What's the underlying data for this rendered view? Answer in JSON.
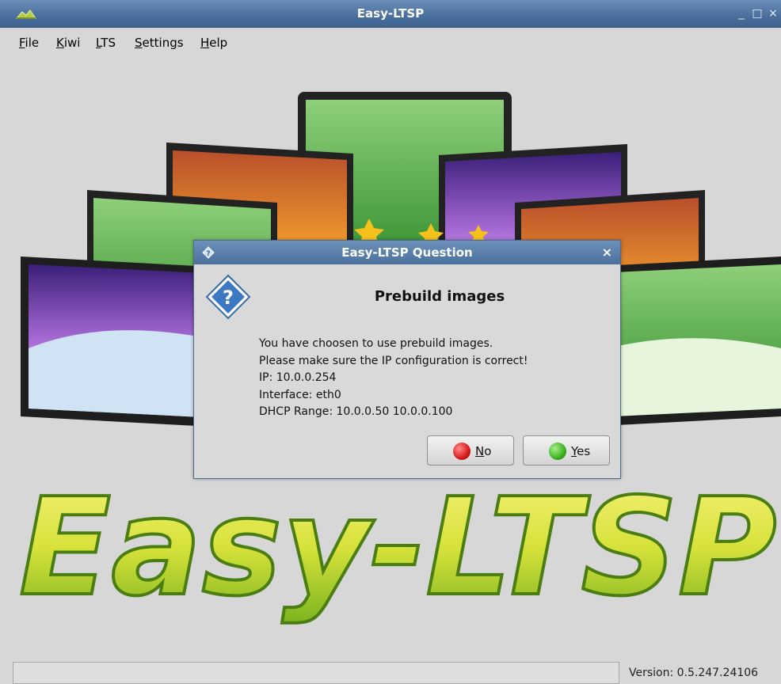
{
  "window": {
    "title": "Easy-LTSP",
    "minimize": "_",
    "maximize": "□",
    "close": "×"
  },
  "menu": [
    {
      "mnemonic": "F",
      "rest": "ile"
    },
    {
      "mnemonic": "K",
      "rest": "iwi"
    },
    {
      "mnemonic": "L",
      "rest": "TS"
    },
    {
      "mnemonic": "S",
      "rest": "ettings"
    },
    {
      "mnemonic": "H",
      "rest": "elp"
    }
  ],
  "splash": {
    "logo_text": "Easy-LTSP"
  },
  "dialog": {
    "title": "Easy-LTSP Question",
    "close": "×",
    "heading": "Prebuild images",
    "lines": [
      "You have choosen to use prebuild images.",
      "Please make sure the IP configuration is correct!",
      "IP: 10.0.0.254",
      "Interface: eth0",
      "DHCP Range: 10.0.0.50 10.0.0.100"
    ],
    "no_button": {
      "mnemonic": "N",
      "rest": "o",
      "color": "#d81a1a"
    },
    "yes_button": {
      "mnemonic": "Y",
      "rest": "es",
      "color": "#3bb21e"
    }
  },
  "status": {
    "text": "",
    "version": "Version: 0.5.247.24106"
  }
}
